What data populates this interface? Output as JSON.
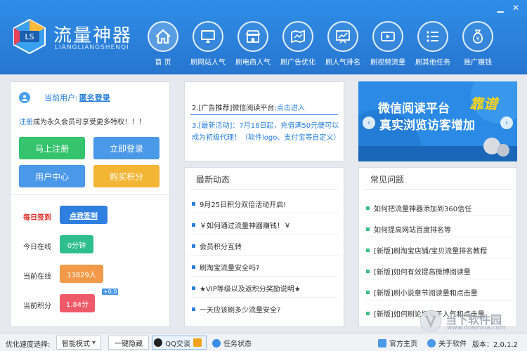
{
  "app": {
    "name": "流量神器",
    "subtitle": "LIANGLIANGSHENQI",
    "logo_text": "LS"
  },
  "window_controls": [
    "▁",
    "✕"
  ],
  "nav": [
    {
      "label": "首 页",
      "icon": "home-icon"
    },
    {
      "label": "刷网站人气",
      "icon": "monitor-icon"
    },
    {
      "label": "刷电商人气",
      "icon": "store-icon"
    },
    {
      "label": "刷广告优化",
      "icon": "map-icon"
    },
    {
      "label": "刷人气排名",
      "icon": "chart-icon"
    },
    {
      "label": "刷视频流量",
      "icon": "video-icon"
    },
    {
      "label": "刷其他任务",
      "icon": "list-icon"
    },
    {
      "label": "推广赚钱",
      "icon": "money-bag-icon"
    }
  ],
  "user": {
    "label": "当前用户:",
    "login_link": "匿名登录",
    "hint_link": "注册",
    "hint_rest": "成为永久会员可享受更多特权！！！"
  },
  "buttons": {
    "register": "马上注册",
    "login": "立即登录",
    "user_center": "用户中心",
    "buy_points": "购买积分"
  },
  "stats": {
    "checkin_label": "每日签到",
    "checkin_button": "点我签到",
    "online_today_label": "今日在线",
    "online_today_value": "0分钟",
    "current_online_label": "当前在线",
    "current_online_value": "13829人",
    "current_points_label": "当前积分",
    "current_points_value": "1.84分",
    "plus_badge": "+0.0"
  },
  "notice": {
    "line1_prefix": "2.[广告推荐]微信阅读平台:",
    "line1_link": "点击进入",
    "line2": "3.[最新活动]：7月18日起，充值满50元便可以成为初级代理！（软件logo、支付宝等自定义）"
  },
  "banner": {
    "line1": "微信阅读平台",
    "highlight": "靠谱",
    "line2": "真实浏览访客增加",
    "prev": "‹",
    "next": "›"
  },
  "news": {
    "title": "最新动态",
    "items": [
      "9月25日积分双倍活动开启!",
      "￥如何通过流量神器赚钱！￥",
      "会员积分互转",
      "刷淘宝流量安全吗?",
      "★VIP等级以及返积分奖励说明★",
      "一天应该刷多少流量安全?"
    ]
  },
  "faq": {
    "title": "常见问题",
    "items": [
      "如何把流量神器添加到360信任",
      "如何提高网站百度排名等",
      "[新版]刷淘宝店铺/宝贝流量排名教程",
      "[新版]如何有效提高微博阅读量",
      "[新版]刷小说章节阅读量和点击量",
      "[新版]如何刷论坛帖子人气和点击量"
    ]
  },
  "statusbar": {
    "speed_label": "优化速度选择:",
    "mode": "智能模式",
    "mode_arrow": "▾",
    "hide_button": "一键隐藏",
    "qq_label": "QQ交谈",
    "task_status": "任务状态",
    "homepage": "官方主页",
    "about": "关于软件",
    "version": "版本：2.0.1.2"
  },
  "watermark": {
    "text": "当下软件园",
    "url": "www.downxia.com"
  }
}
